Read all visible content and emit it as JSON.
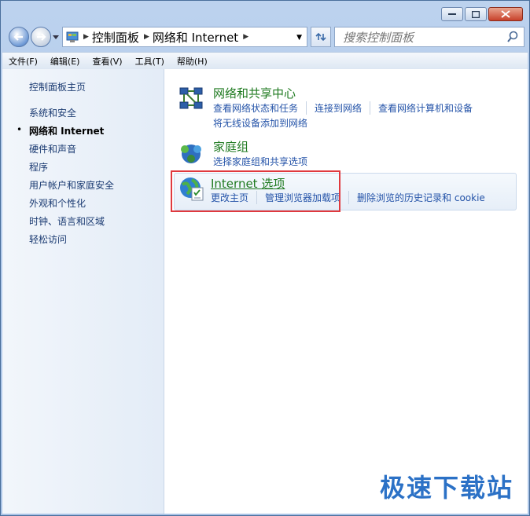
{
  "address": {
    "seg1": "控制面板",
    "seg2": "网络和 Internet"
  },
  "search": {
    "placeholder": "搜索控制面板"
  },
  "menu": [
    "文件(F)",
    "编辑(E)",
    "查看(V)",
    "工具(T)",
    "帮助(H)"
  ],
  "sidebar": {
    "home": "控制面板主页",
    "items": [
      "系统和安全",
      "网络和 Internet",
      "硬件和声音",
      "程序",
      "用户帐户和家庭安全",
      "外观和个性化",
      "时钟、语言和区域",
      "轻松访问"
    ],
    "current_index": 1
  },
  "categories": [
    {
      "title": "网络和共享中心",
      "links": [
        "查看网络状态和任务",
        "连接到网络",
        "查看网络计算机和设备"
      ],
      "links2": [
        "将无线设备添加到网络"
      ]
    },
    {
      "title": "家庭组",
      "links": [
        "选择家庭组和共享选项"
      ]
    },
    {
      "title": "Internet 选项",
      "links": [
        "更改主页",
        "管理浏览器加载项",
        "删除浏览的历史记录和 cookie"
      ]
    }
  ],
  "watermark": "极速下载站",
  "colors": {
    "link": "#2453a8",
    "category_title": "#1f7a20",
    "highlight": "#e0393e"
  }
}
